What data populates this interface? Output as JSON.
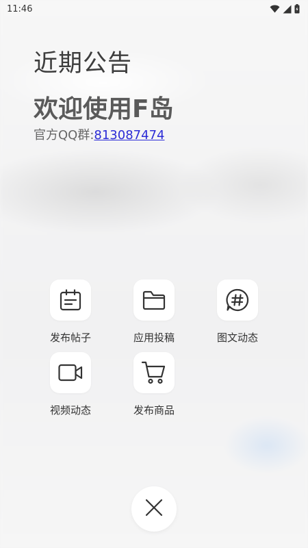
{
  "status_bar": {
    "time": "11:46",
    "icons": [
      "wifi-icon",
      "signal-icon",
      "battery-icon"
    ]
  },
  "announcement": {
    "label": "近期公告",
    "title": "欢迎使用F岛",
    "qq_prefix": "官方QQ群:",
    "qq_number": "813087474"
  },
  "actions": [
    {
      "label": "发布帖子",
      "icon": "post-icon"
    },
    {
      "label": "应用投稿",
      "icon": "folder-icon"
    },
    {
      "label": "图文动态",
      "icon": "hashtag-icon"
    },
    {
      "label": "视频动态",
      "icon": "video-icon"
    },
    {
      "label": "发布商品",
      "icon": "cart-icon"
    }
  ],
  "close_button": {
    "icon": "close-icon"
  },
  "colors": {
    "accent_link": "#2b2bd6",
    "text_primary": "#333333",
    "icon_stroke": "#333333"
  }
}
